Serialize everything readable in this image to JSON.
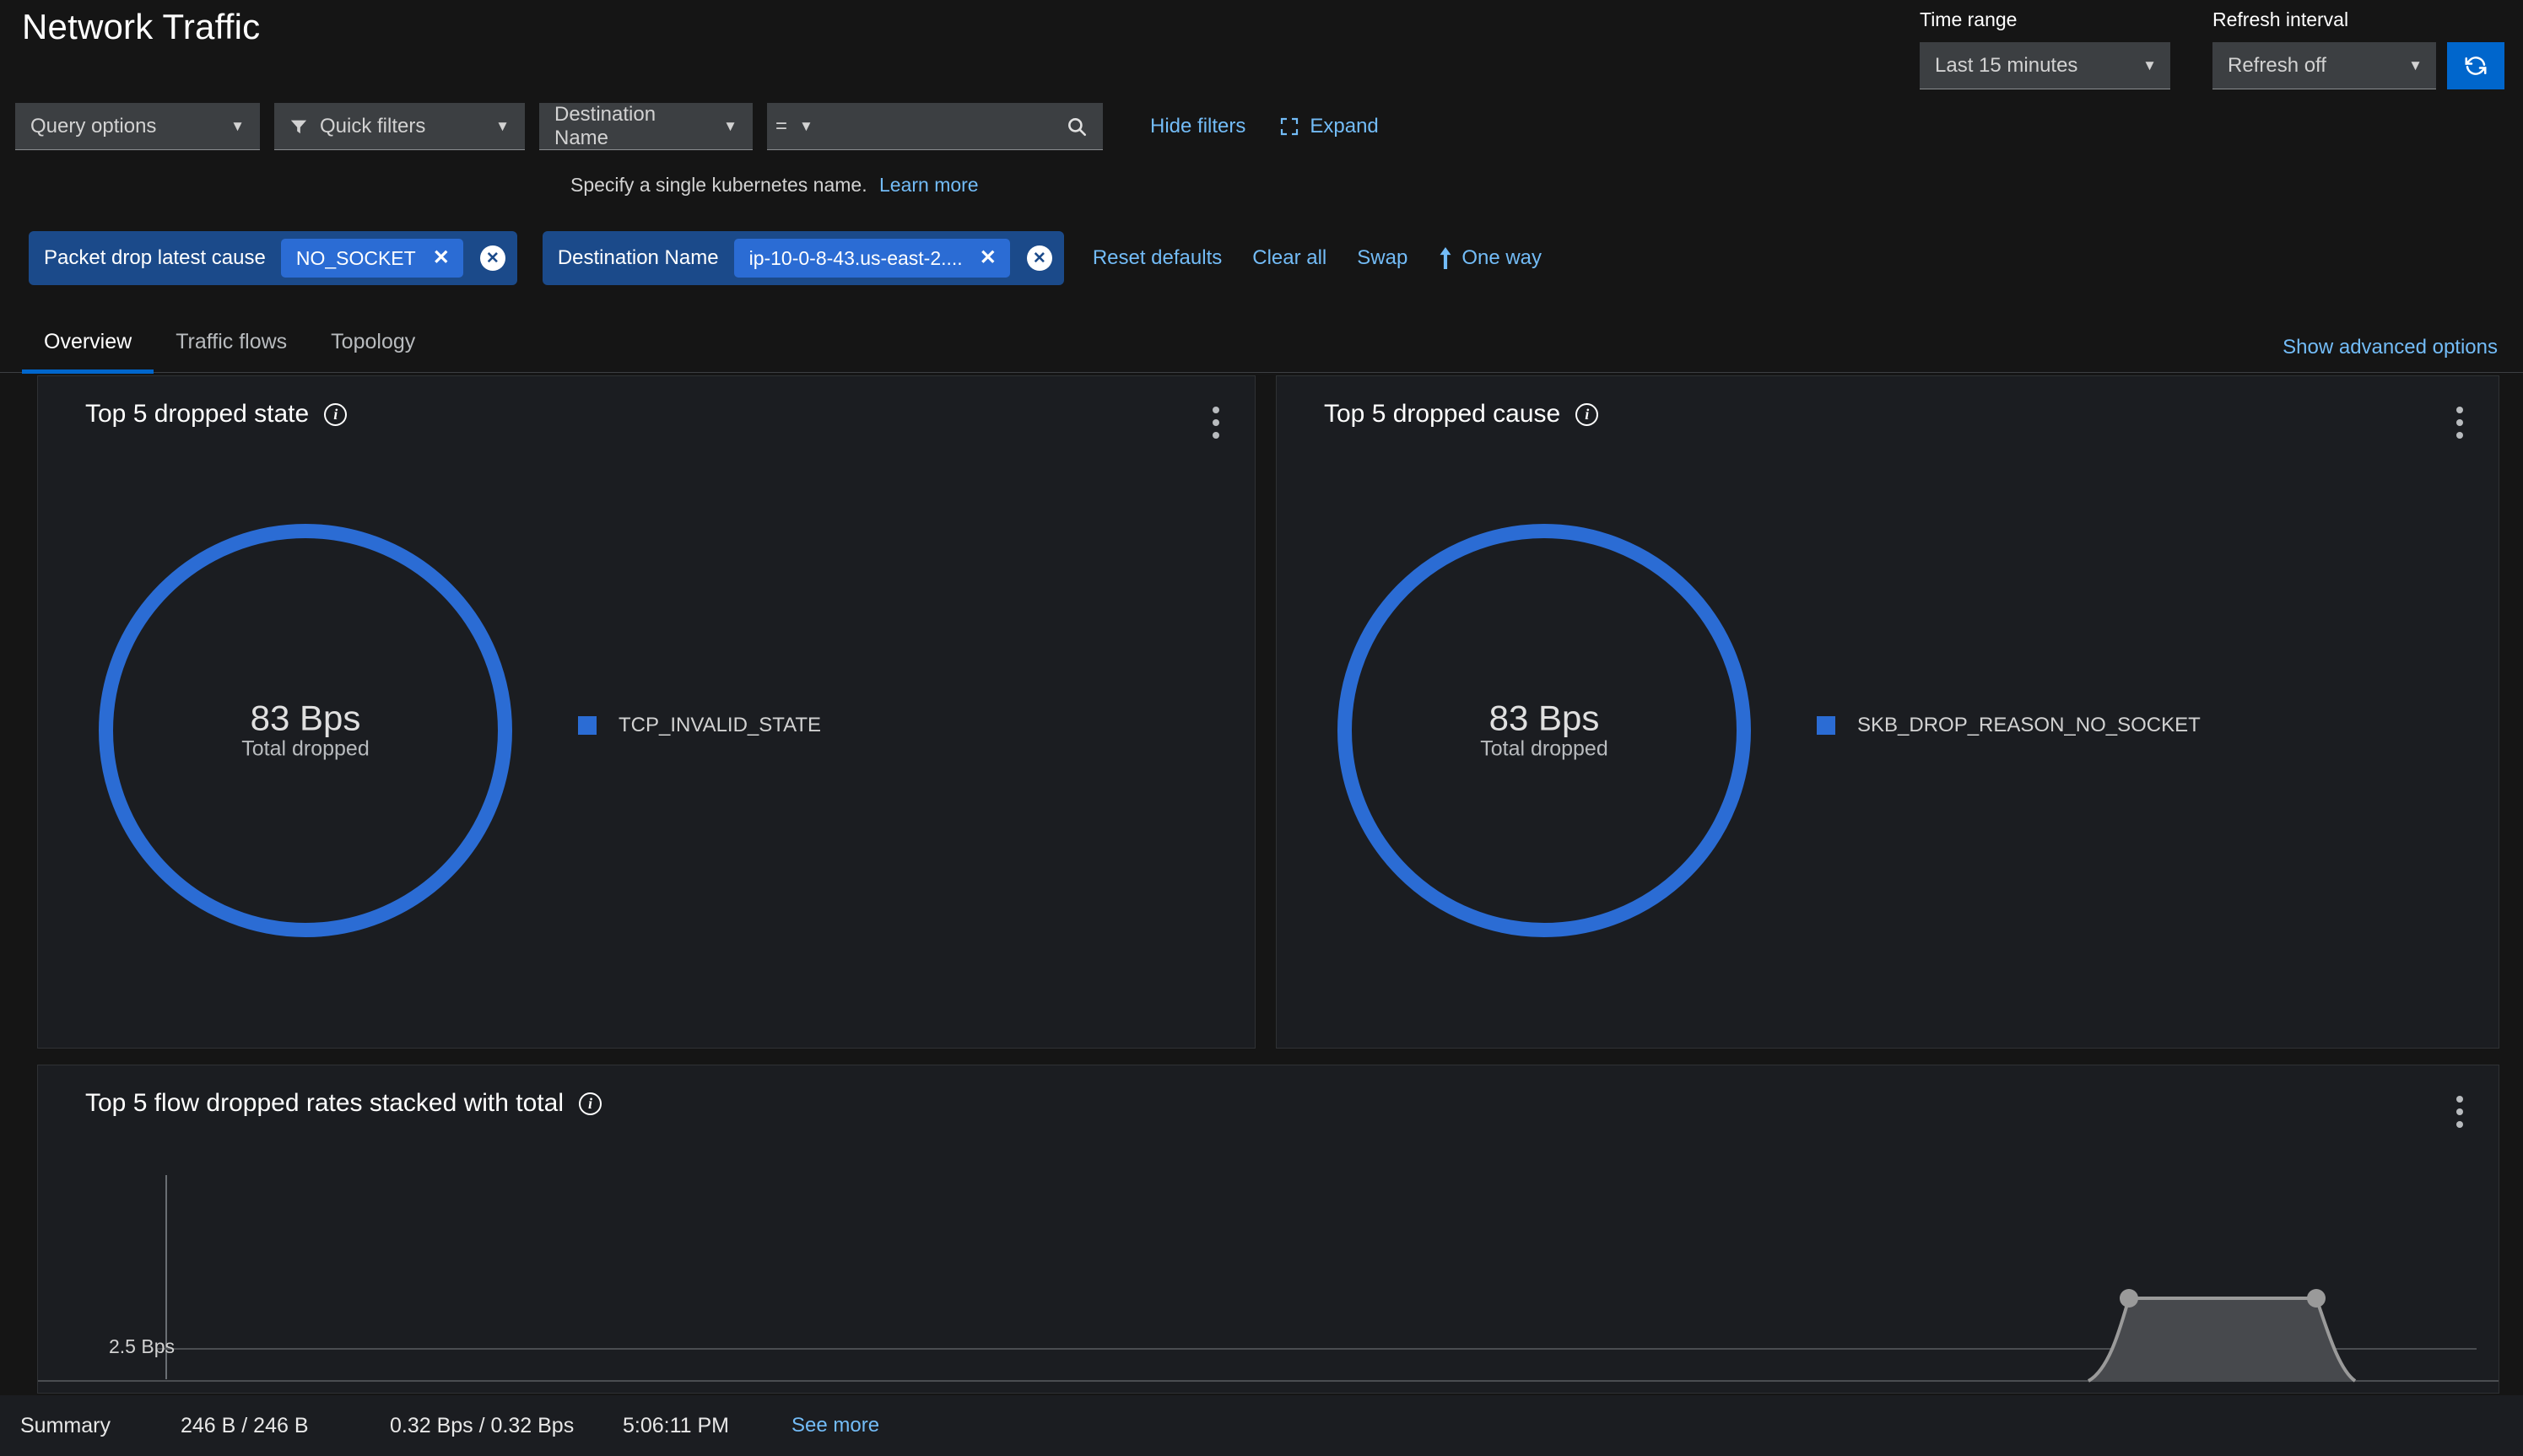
{
  "header": {
    "title": "Network Traffic",
    "time_range": {
      "label": "Time range",
      "value": "Last 15 minutes"
    },
    "refresh": {
      "label": "Refresh interval",
      "value": "Refresh off",
      "button_icon": "refresh-icon"
    }
  },
  "query_bar": {
    "query_options": "Query options",
    "quick_filters": "Quick filters",
    "filter_field": "Destination Name",
    "operator": "=",
    "value_placeholder": "",
    "value": "",
    "search_icon": "search-icon",
    "hide_filters": "Hide filters",
    "expand": "Expand",
    "hint_text": "Specify a single kubernetes name.",
    "hint_link": "Learn more"
  },
  "filters": {
    "chips": [
      {
        "category": "Packet drop latest cause",
        "value": "NO_SOCKET"
      },
      {
        "category": "Destination Name",
        "value": "ip-10-0-8-43.us-east-2...."
      }
    ],
    "actions": {
      "reset_defaults": "Reset defaults",
      "clear_all": "Clear all",
      "swap": "Swap",
      "one_way": "One way",
      "one_way_icon": "arrow-up-icon"
    }
  },
  "tabs": {
    "items": [
      {
        "label": "Overview",
        "active": true
      },
      {
        "label": "Traffic flows",
        "active": false
      },
      {
        "label": "Topology",
        "active": false
      }
    ],
    "advanced_options": "Show advanced options"
  },
  "panels": {
    "dropped_state": {
      "title": "Top 5 dropped state",
      "total_value": "83 Bps",
      "total_label": "Total dropped",
      "legend": [
        {
          "label": "TCP_INVALID_STATE",
          "color": "#2b6cd4"
        }
      ]
    },
    "dropped_cause": {
      "title": "Top 5 dropped cause",
      "total_value": "83 Bps",
      "total_label": "Total dropped",
      "legend": [
        {
          "label": "SKB_DROP_REASON_NO_SOCKET",
          "color": "#2b6cd4"
        }
      ]
    },
    "flow_rates": {
      "title": "Top 5 flow dropped rates stacked with total",
      "y_tick": "2.5 Bps"
    }
  },
  "summary": {
    "title": "Summary",
    "bytes": "246 B / 246 B",
    "rates": "0.32 Bps / 0.32 Bps",
    "time": "5:06:11 PM",
    "see_more": "See more"
  },
  "chart_data": {
    "type": "area",
    "title": "Top 5 flow dropped rates stacked with total",
    "xlabel": "",
    "ylabel": "",
    "ytick_labels": [
      "2.5 Bps"
    ],
    "ylim": [
      0,
      5
    ],
    "grid": true,
    "legend_position": "none",
    "series": [
      {
        "name": "total",
        "color": "#9a9a9a",
        "x": [
          0,
          0.8,
          0.845,
          0.855,
          0.935,
          0.945,
          1.0
        ],
        "values": [
          0,
          0,
          2.5,
          2.5,
          2.5,
          0,
          0
        ]
      }
    ],
    "markers": [
      {
        "x": 0.855,
        "y": 2.5
      },
      {
        "x": 0.935,
        "y": 2.5
      }
    ]
  }
}
